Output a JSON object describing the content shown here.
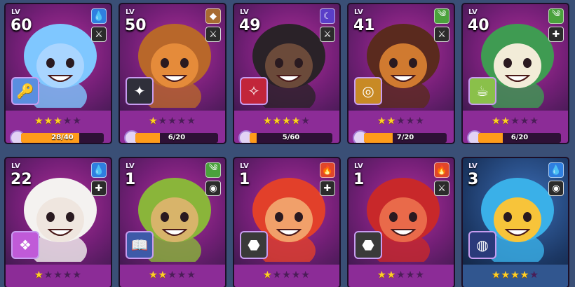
{
  "cookies": [
    {
      "lv_label": "LV",
      "level": "60",
      "element": "water",
      "element_color": "#2f7fe0",
      "element_glyph": "💧",
      "type_glyph": "⚔",
      "skill_color": "#5a8ee0",
      "skill_glyph": "🔑",
      "body_color": "#a9d5ff",
      "hair_color": "#7fc7ff",
      "stars": 3,
      "max_stars": 5,
      "progress": 0.7,
      "progress_text": "28/40"
    },
    {
      "lv_label": "LV",
      "level": "50",
      "element": "earth",
      "element_color": "#a86b32",
      "element_glyph": "◆",
      "type_glyph": "⚔",
      "skill_color": "#2f2f3a",
      "skill_glyph": "✦",
      "body_color": "#e58b3a",
      "hair_color": "#b8672a",
      "stars": 1,
      "max_stars": 5,
      "progress": 0.3,
      "progress_text": "6/20"
    },
    {
      "lv_label": "LV",
      "level": "49",
      "element": "darkness",
      "element_color": "#5a3ec8",
      "element_glyph": "☾",
      "type_glyph": "⚔",
      "skill_color": "#c2253a",
      "skill_glyph": "✧",
      "body_color": "#6b4a3a",
      "hair_color": "#2a2228",
      "stars": 4,
      "max_stars": 5,
      "progress": 0.083,
      "progress_text": "5/60"
    },
    {
      "lv_label": "LV",
      "level": "41",
      "element": "wind",
      "element_color": "#4aa23c",
      "element_glyph": "༄",
      "type_glyph": "⚔",
      "skill_color": "#c88a25",
      "skill_glyph": "◎",
      "body_color": "#d07a30",
      "hair_color": "#5a2a1e",
      "stars": 2,
      "max_stars": 5,
      "progress": 0.35,
      "progress_text": "7/20"
    },
    {
      "lv_label": "LV",
      "level": "40",
      "element": "wind",
      "element_color": "#4aa23c",
      "element_glyph": "༄",
      "type_glyph": "✚",
      "skill_color": "#8ac04a",
      "skill_glyph": "☕",
      "body_color": "#f2ecd8",
      "hair_color": "#3f9b52",
      "stars": 2,
      "max_stars": 5,
      "progress": 0.3,
      "progress_text": "6/20"
    },
    {
      "lv_label": "LV",
      "level": "22",
      "element": "water",
      "element_color": "#2f7fe0",
      "element_glyph": "💧",
      "type_glyph": "✚",
      "skill_color": "#c05ad8",
      "skill_glyph": "❖",
      "body_color": "#efe6df",
      "hair_color": "#f4f2f0",
      "stars": 1,
      "max_stars": 5,
      "progress": null,
      "progress_text": ""
    },
    {
      "lv_label": "LV",
      "level": "1",
      "element": "wind",
      "element_color": "#4aa23c",
      "element_glyph": "༄",
      "type_glyph": "◉",
      "skill_color": "#3d5aa8",
      "skill_glyph": "📖",
      "body_color": "#d8b46a",
      "hair_color": "#8ab53a",
      "stars": 2,
      "max_stars": 5,
      "progress": null,
      "progress_text": ""
    },
    {
      "lv_label": "LV",
      "level": "1",
      "element": "fire",
      "element_color": "#e0462a",
      "element_glyph": "🔥",
      "type_glyph": "✚",
      "skill_color": "#3a3a3a",
      "skill_glyph": "⬣",
      "body_color": "#f1a06a",
      "hair_color": "#e2402a",
      "stars": 1,
      "max_stars": 5,
      "progress": null,
      "progress_text": ""
    },
    {
      "lv_label": "LV",
      "level": "1",
      "element": "fire",
      "element_color": "#e0462a",
      "element_glyph": "🔥",
      "type_glyph": "⚔",
      "skill_color": "#3a3a3a",
      "skill_glyph": "⬣",
      "body_color": "#e96a4a",
      "hair_color": "#c8282a",
      "stars": 2,
      "max_stars": 5,
      "progress": null,
      "progress_text": ""
    },
    {
      "lv_label": "LV",
      "level": "3",
      "element": "water",
      "element_color": "#2f7fe0",
      "element_glyph": "💧",
      "type_glyph": "◉",
      "skill_color": "#2a3a7a",
      "skill_glyph": "◍",
      "body_color": "#f7c43a",
      "hair_color": "#3ab0e8",
      "stars": 4,
      "max_stars": 5,
      "progress": null,
      "progress_text": "",
      "blue_bg": true
    }
  ]
}
